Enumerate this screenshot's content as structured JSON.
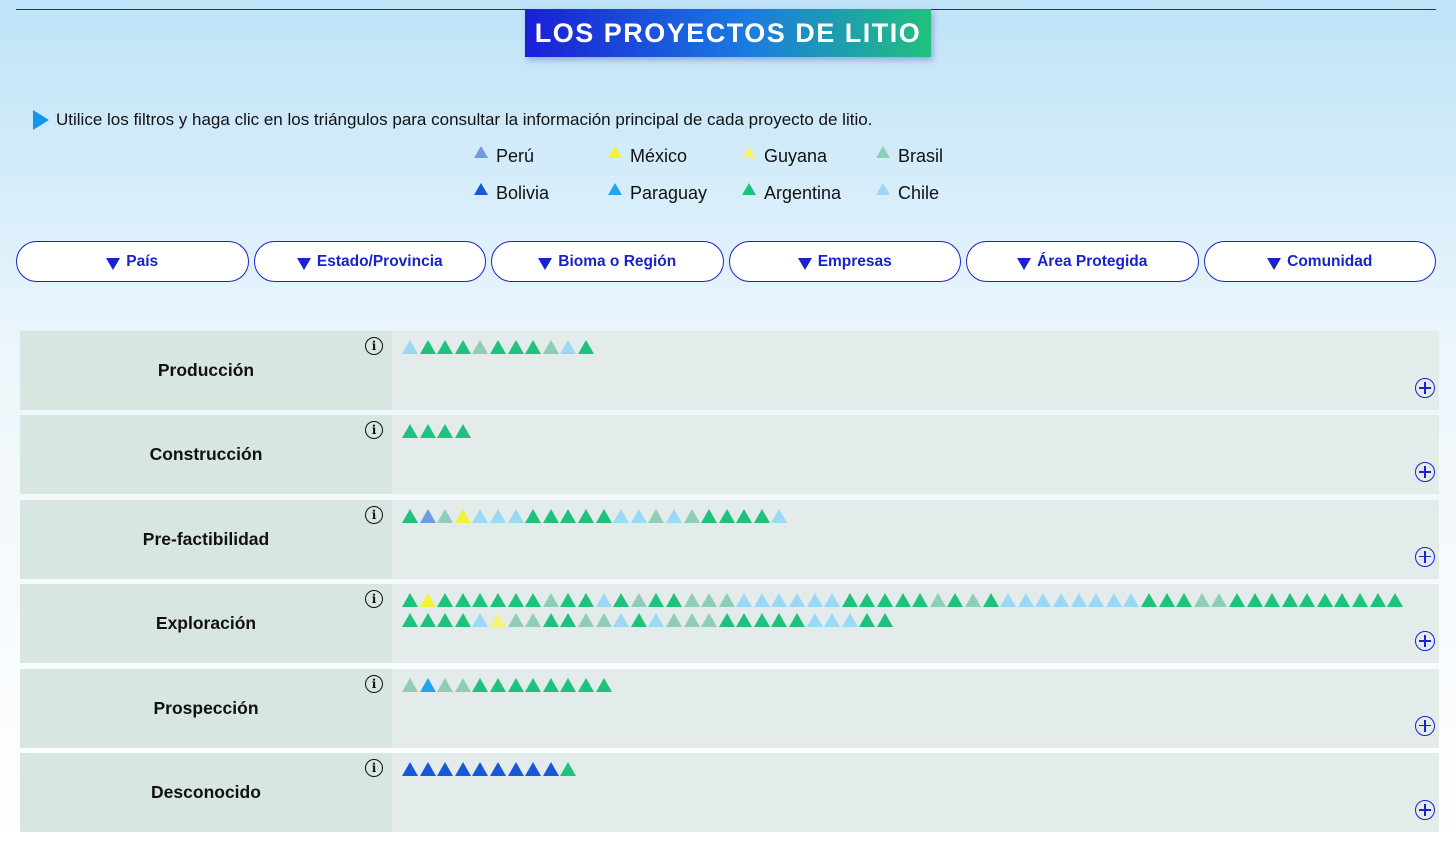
{
  "title": "LOS PROYECTOS DE LITIO",
  "instruction": "Utilice los filtros y haga clic en los triángulos para consultar la información principal de cada proyecto de litio.",
  "colors": {
    "Perú": "#6f9be6",
    "México": "#f2f23a",
    "Guyana": "#f4f47a",
    "Brasil": "#8ecdb6",
    "Bolivia": "#1857d8",
    "Paraguay": "#23a4ef",
    "Argentina": "#1fc27c",
    "Chile": "#9bd8f6"
  },
  "legend": [
    {
      "label": "Perú",
      "key": "Perú"
    },
    {
      "label": "México",
      "key": "México"
    },
    {
      "label": "Guyana",
      "key": "Guyana"
    },
    {
      "label": "Brasil",
      "key": "Brasil"
    },
    {
      "label": "Bolivia",
      "key": "Bolivia"
    },
    {
      "label": "Paraguay",
      "key": "Paraguay"
    },
    {
      "label": "Argentina",
      "key": "Argentina"
    },
    {
      "label": "Chile",
      "key": "Chile"
    }
  ],
  "filters": [
    {
      "label": "País",
      "name": "filter-pais"
    },
    {
      "label": "Estado/Provincia",
      "name": "filter-estado-provincia"
    },
    {
      "label": "Bioma o Región",
      "name": "filter-bioma-region"
    },
    {
      "label": "Empresas",
      "name": "filter-empresas"
    },
    {
      "label": "Área Protegida",
      "name": "filter-area-protegida"
    },
    {
      "label": "Comunidad",
      "name": "filter-comunidad"
    }
  ],
  "stages": [
    {
      "label": "Producción",
      "projects": [
        "Chile",
        "Argentina",
        "Argentina",
        "Argentina",
        "Brasil",
        "Argentina",
        "Argentina",
        "Argentina",
        "Brasil",
        "Chile",
        "Argentina"
      ]
    },
    {
      "label": "Construcción",
      "projects": [
        "Argentina",
        "Argentina",
        "Argentina",
        "Argentina"
      ]
    },
    {
      "label": "Pre-factibilidad",
      "projects": [
        "Argentina",
        "Perú",
        "Brasil",
        "México",
        "Chile",
        "Chile",
        "Chile",
        "Argentina",
        "Argentina",
        "Argentina",
        "Argentina",
        "Argentina",
        "Chile",
        "Chile",
        "Brasil",
        "Chile",
        "Brasil",
        "Argentina",
        "Argentina",
        "Argentina",
        "Argentina",
        "Chile"
      ]
    },
    {
      "label": "Exploración",
      "projects": [
        "Argentina",
        "México",
        "Argentina",
        "Argentina",
        "Argentina",
        "Argentina",
        "Argentina",
        "Argentina",
        "Brasil",
        "Argentina",
        "Argentina",
        "Chile",
        "Argentina",
        "Brasil",
        "Argentina",
        "Argentina",
        "Brasil",
        "Brasil",
        "Brasil",
        "Chile",
        "Chile",
        "Chile",
        "Chile",
        "Chile",
        "Chile",
        "Argentina",
        "Argentina",
        "Argentina",
        "Argentina",
        "Argentina",
        "Brasil",
        "Argentina",
        "Brasil",
        "Argentina",
        "Chile",
        "Chile",
        "Chile",
        "Chile",
        "Chile",
        "Chile",
        "Chile",
        "Chile",
        "Argentina",
        "Argentina",
        "Argentina",
        "Brasil",
        "Brasil",
        "Argentina",
        "Argentina",
        "Argentina",
        "Argentina",
        "Argentina",
        "Argentina",
        "Argentina",
        "Argentina",
        "Argentina",
        "Argentina",
        "Argentina",
        "Argentina",
        "Argentina",
        "Argentina",
        "Chile",
        "Guyana",
        "Brasil",
        "Brasil",
        "Argentina",
        "Argentina",
        "Brasil",
        "Brasil",
        "Chile",
        "Argentina",
        "Chile",
        "Brasil",
        "Brasil",
        "Brasil",
        "Argentina",
        "Argentina",
        "Argentina",
        "Argentina",
        "Argentina",
        "Chile",
        "Chile",
        "Chile",
        "Argentina",
        "Argentina"
      ]
    },
    {
      "label": "Prospección",
      "projects": [
        "Brasil",
        "Paraguay",
        "Brasil",
        "Brasil",
        "Argentina",
        "Argentina",
        "Argentina",
        "Argentina",
        "Argentina",
        "Argentina",
        "Argentina",
        "Argentina"
      ]
    },
    {
      "label": "Desconocido",
      "projects": [
        "Bolivia",
        "Bolivia",
        "Bolivia",
        "Bolivia",
        "Bolivia",
        "Bolivia",
        "Bolivia",
        "Bolivia",
        "Bolivia",
        "Argentina"
      ]
    }
  ],
  "icons": {
    "info": "info-icon",
    "expand": "plus-circle-icon",
    "filter": "caret-down-icon",
    "bullet": "play-icon"
  }
}
